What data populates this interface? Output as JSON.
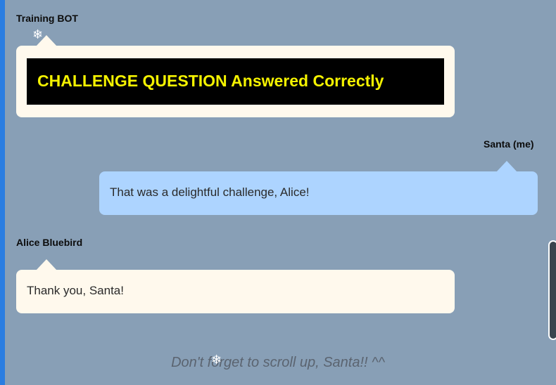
{
  "chat": {
    "messages": [
      {
        "sender": "Training BOT",
        "text": "CHALLENGE QUESTION Answered Correctly"
      },
      {
        "sender": "Santa (me)",
        "text": "That was a delightful challenge, Alice!"
      },
      {
        "sender": "Alice Bluebird",
        "text": "Thank you, Santa!"
      }
    ],
    "footer": "Don't forget to scroll up, Santa!! ^^"
  },
  "icons": {
    "snowflake": "snowflake-icon"
  },
  "colors": {
    "background": "#889fb6",
    "accent_bar": "#2a7de1",
    "bot_bubble": "#fff9ed",
    "me_bubble": "#add4ff",
    "challenge_bg": "#000000",
    "challenge_text": "#f4f200"
  }
}
